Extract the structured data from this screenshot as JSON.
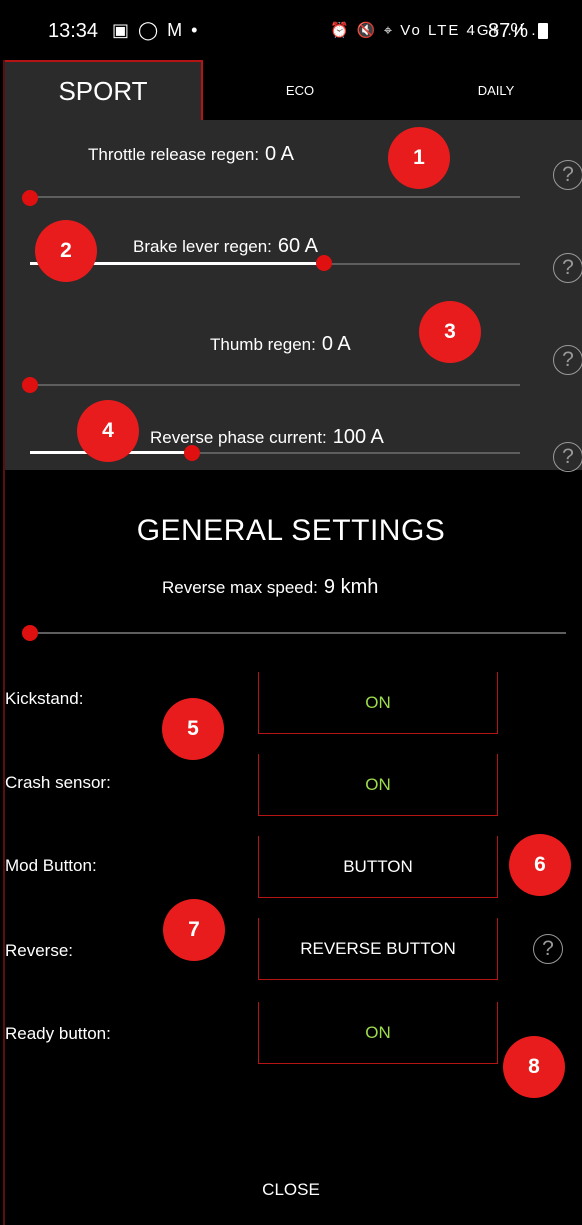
{
  "status_bar": {
    "time": "13:34",
    "left_icons": "▣ ◯ M •",
    "right_icons": "⏰ 🔇 ⌖ Vo LTE 4G+ .ıl .ıl",
    "battery": "87%"
  },
  "tabs": [
    {
      "label": "SPORT",
      "active": true
    },
    {
      "label": "ECO",
      "active": false
    },
    {
      "label": "DAILY",
      "active": false
    }
  ],
  "sport_settings": [
    {
      "label": "Throttle release regen:",
      "value": "0 A",
      "level": 0.0
    },
    {
      "label": "Brake lever regen:",
      "value": "60 A",
      "level": 0.6
    },
    {
      "label": "Thumb regen:",
      "value": "0 A",
      "level": 0.0
    },
    {
      "label": "Reverse phase current:",
      "value": "100 A",
      "level": 0.33
    }
  ],
  "help_glyph": "?",
  "general": {
    "title": "GENERAL SETTINGS",
    "reverse_speed": {
      "label": "Reverse max speed:",
      "value": "9 kmh",
      "level": 0.0
    },
    "rows": [
      {
        "label": "Kickstand:",
        "value": "ON",
        "state": "on"
      },
      {
        "label": "Crash sensor:",
        "value": "ON",
        "state": "on"
      },
      {
        "label": "Mod Button:",
        "value": "BUTTON",
        "state": "text"
      },
      {
        "label": "Reverse:",
        "value": "REVERSE BUTTON",
        "state": "text"
      },
      {
        "label": "Ready button:",
        "value": "ON",
        "state": "on"
      }
    ]
  },
  "badges": [
    "1",
    "2",
    "3",
    "4",
    "5",
    "6",
    "7",
    "8"
  ],
  "close_label": "CLOSE",
  "colors": {
    "accent_red": "#e01010",
    "panel_gray": "#2b2b2b",
    "on_green": "#9edc4c",
    "border_red": "#b41414"
  }
}
